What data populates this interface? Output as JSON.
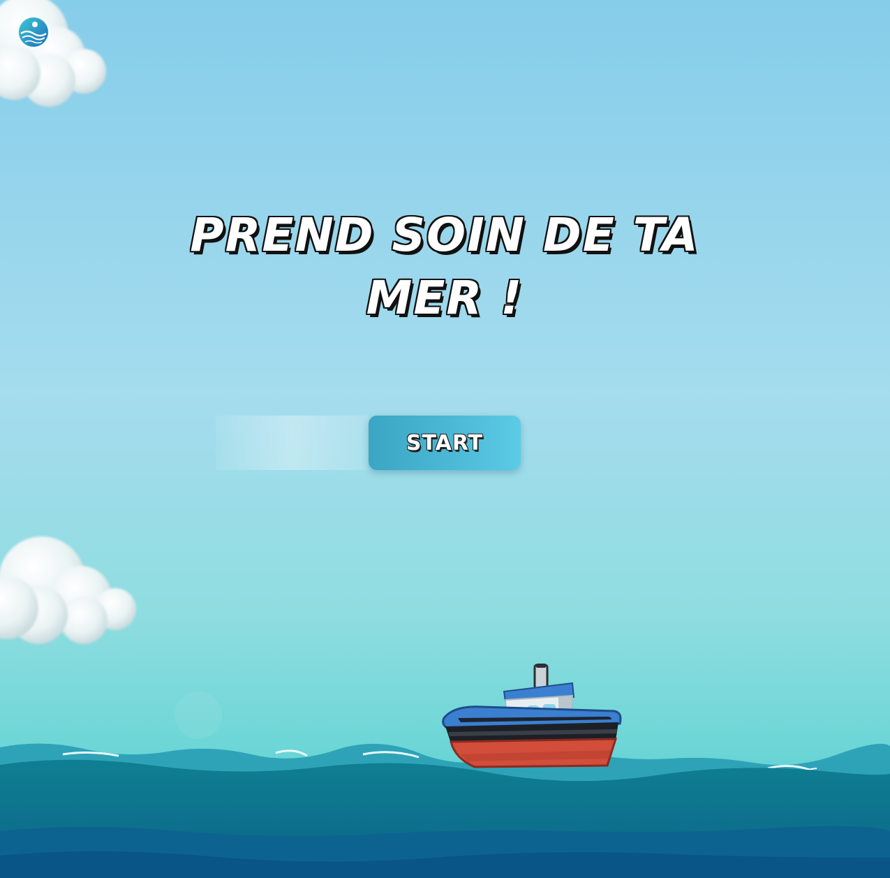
{
  "game": {
    "title_line1": "PREND SOIN DE TA",
    "title_line2": "MER !",
    "start_label": "START",
    "name_input_value": "",
    "name_input_placeholder": ""
  },
  "icons": {
    "logo": "ocean-wave-logo-icon",
    "boat": "boat-icon",
    "clouds": "cloud-icon",
    "sea": "sea-waves"
  },
  "colors": {
    "sky_top": "#86cdea",
    "sky_bottom": "#6dd6d6",
    "button": "#4ab7d4",
    "title_text": "#ffffff",
    "title_outline": "#111111",
    "boat_hull_red": "#d24d3a",
    "boat_hull_blue": "#3b7fd0",
    "sea_light": "#2ea3b8",
    "sea_deep": "#0b5d8f"
  }
}
